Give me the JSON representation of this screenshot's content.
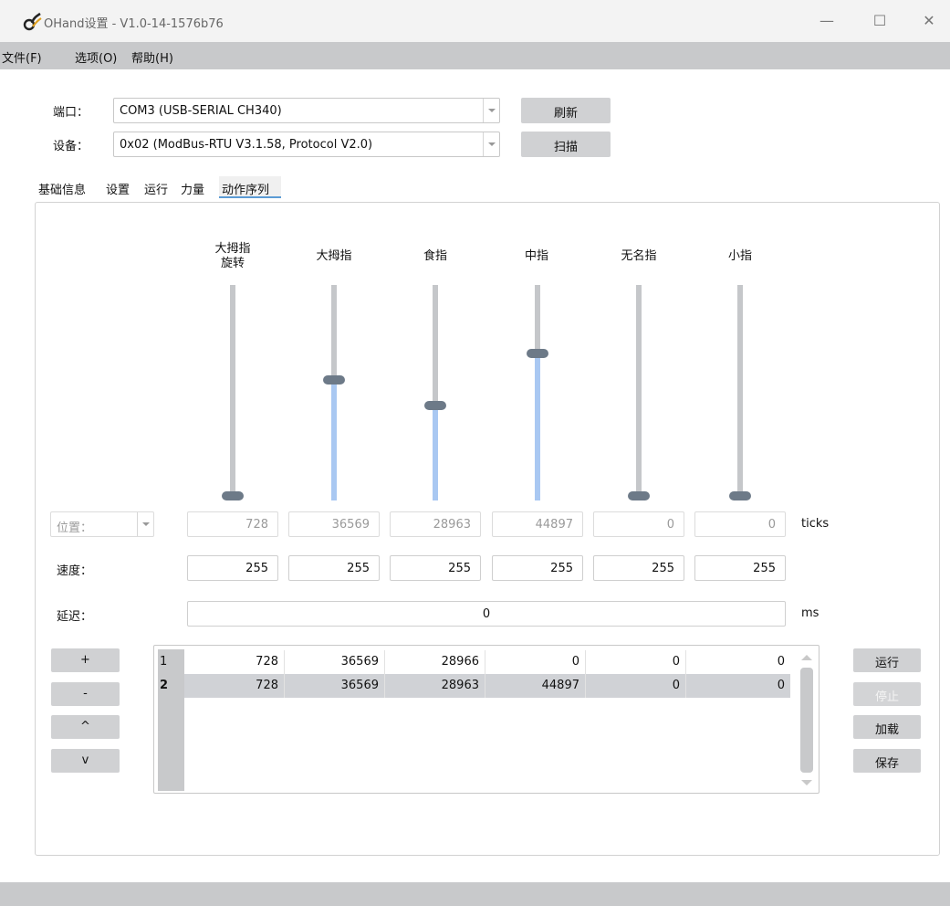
{
  "window": {
    "title": "OHand设置 - V1.0-14-1576b76",
    "minimize": "—",
    "maximize": "☐",
    "close": "✕"
  },
  "menu": [
    "文件(F)",
    "选项(O)",
    "帮助(H)"
  ],
  "port": {
    "label": "端口：",
    "value": "COM3 (USB-SERIAL CH340)",
    "button": "刷新"
  },
  "device": {
    "label": "设备：",
    "value": "0x02 (ModBus-RTU V3.1.58, Protocol V2.0)",
    "button": "扫描"
  },
  "tabs": [
    "基础信息",
    "设置",
    "运行",
    "力量",
    "动作序列"
  ],
  "active_tab": "动作序列",
  "fingers": [
    {
      "label": "大拇指\n旋转",
      "level": 0.0
    },
    {
      "label": "大拇指",
      "level": 0.56
    },
    {
      "label": "食指",
      "level": 0.44
    },
    {
      "label": "中指",
      "level": 0.69
    },
    {
      "label": "无名指",
      "level": 0.0
    },
    {
      "label": "小指",
      "level": 0.0
    }
  ],
  "position": {
    "mode": "位置：",
    "values": [
      "728",
      "36569",
      "28963",
      "44897",
      "0",
      "0"
    ],
    "unit": "ticks"
  },
  "speed": {
    "label": "速度：",
    "values": [
      "255",
      "255",
      "255",
      "255",
      "255",
      "255"
    ]
  },
  "delay": {
    "label": "延迟：",
    "value": "0",
    "unit": "ms"
  },
  "list_buttons": [
    "+",
    "-",
    "^",
    "v"
  ],
  "sequence": {
    "rows": [
      {
        "num": "1",
        "cells": [
          "728",
          "36569",
          "28966",
          "0",
          "0",
          "0"
        ]
      },
      {
        "num": "2",
        "cells": [
          "728",
          "36569",
          "28963",
          "44897",
          "0",
          "0"
        ]
      }
    ]
  },
  "action_buttons": {
    "run": "运行",
    "stop": "停止",
    "load": "加载",
    "save": "保存"
  },
  "colors": {
    "slider_fill": "#a9c8f2",
    "slider_handle": "#6d7a88",
    "tab_underline": "#5b9bd5"
  }
}
